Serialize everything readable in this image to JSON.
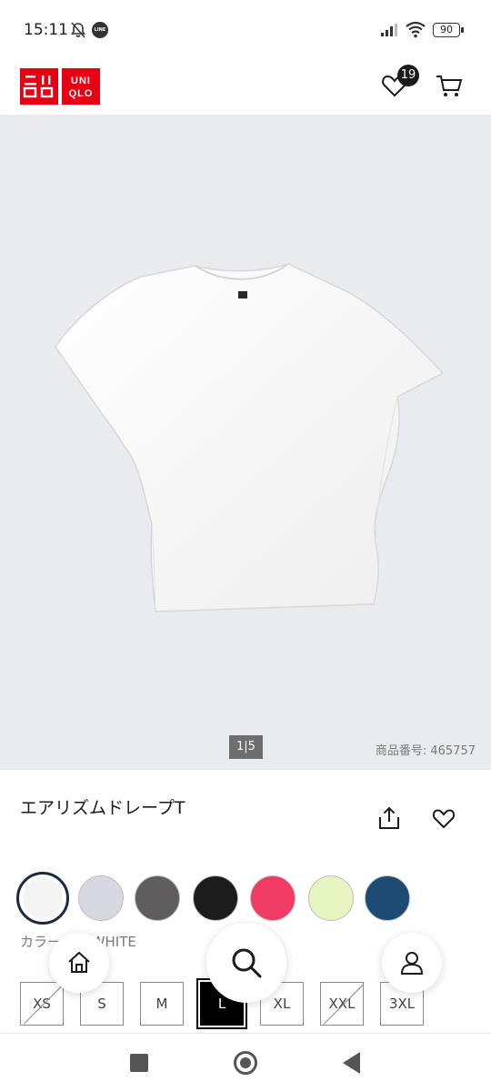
{
  "status_bar": {
    "time": "15:11",
    "line_badge": "LINE",
    "battery": "90"
  },
  "header": {
    "logo_top": "ユニ\nクロ",
    "logo_bottom": "UNI\nQLO",
    "wishlist_count": "19"
  },
  "product": {
    "image_counter": "1|5",
    "id_label": "商品番号:",
    "id_value": "465757",
    "title": "エアリズムドレープT",
    "color_label": "カラー: 00 WHITE"
  },
  "colors": [
    {
      "name": "white",
      "hex": "#f4f4f4",
      "selected": true
    },
    {
      "name": "light-gray",
      "hex": "#d7d8e0",
      "selected": false
    },
    {
      "name": "dark-gray",
      "hex": "#5f5d5e",
      "selected": false
    },
    {
      "name": "black",
      "hex": "#1c1c1c",
      "selected": false
    },
    {
      "name": "pink",
      "hex": "#f03b65",
      "selected": false
    },
    {
      "name": "light-green",
      "hex": "#e6f4c0",
      "selected": false
    },
    {
      "name": "navy",
      "hex": "#1e4b73",
      "selected": false
    }
  ],
  "sizes": [
    {
      "label": "XS",
      "available": false,
      "selected": false
    },
    {
      "label": "S",
      "available": true,
      "selected": false
    },
    {
      "label": "M",
      "available": true,
      "selected": false
    },
    {
      "label": "L",
      "available": true,
      "selected": true
    },
    {
      "label": "XL",
      "available": true,
      "selected": false
    },
    {
      "label": "XXL",
      "available": false,
      "selected": false
    },
    {
      "label": "3XL",
      "available": true,
      "selected": false
    }
  ],
  "icons": {
    "wishlist": "heart-icon",
    "cart": "cart-icon",
    "share": "share-icon",
    "favorite": "heart-outline-icon",
    "home": "home-icon",
    "search": "search-icon",
    "account": "user-icon"
  },
  "brand_color": "#e60012"
}
